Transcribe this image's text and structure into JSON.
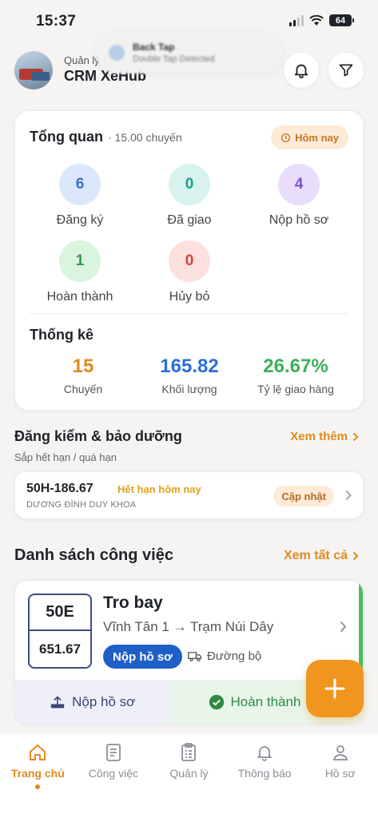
{
  "status_bar": {
    "time": "15:37",
    "battery": "64"
  },
  "notification": {
    "title": "Back Tap",
    "subtitle": "Double Tap Detected"
  },
  "header": {
    "subtitle": "Quản lý",
    "title": "CRM XeHub"
  },
  "overview": {
    "title": "Tổng quan",
    "count_label": "· 15.00 chuyến",
    "period_badge": "Hôm nay",
    "stats": [
      {
        "value": "6",
        "label": "Đăng ký",
        "color": "#3b6fd1",
        "bg": "#dbe7fb"
      },
      {
        "value": "0",
        "label": "Đã giao",
        "color": "#1a9f8e",
        "bg": "#d8f3ef"
      },
      {
        "value": "4",
        "label": "Nộp hồ sơ",
        "color": "#7a4fd1",
        "bg": "#e8ddfb"
      },
      {
        "value": "1",
        "label": "Hoàn thành",
        "color": "#2f9a48",
        "bg": "#d9f4df"
      },
      {
        "value": "0",
        "label": "Hủy bỏ",
        "color": "#d1453b",
        "bg": "#fbe0de"
      }
    ]
  },
  "statistics": {
    "title": "Thống kê",
    "items": [
      {
        "value": "15",
        "label": "Chuyến",
        "color": "#e08a1e"
      },
      {
        "value": "165.82",
        "label": "Khối lượng",
        "color": "#2b6fd6"
      },
      {
        "value": "26.67%",
        "label": "Tỷ lệ giao hàng",
        "color": "#3bb05a"
      }
    ]
  },
  "inspection": {
    "title": "Đăng kiểm & bảo dưỡng",
    "link": "Xem thêm",
    "subtitle": "Sắp hết hạn / quá hạn",
    "item": {
      "plate": "50H-186.67",
      "status": "Hết hạn hôm nay",
      "driver": "DƯƠNG ĐÌNH DUY KHOA",
      "action": "Cập nhật"
    }
  },
  "jobs": {
    "title": "Danh sách công việc",
    "link": "Xem tất cả",
    "item": {
      "plate_top": "50E",
      "plate_bottom": "651.67",
      "title": "Tro bay",
      "route": "Vĩnh Tân 1 → Trạm Núi Dây",
      "status": "Nộp hồ sơ",
      "transport": "Đường bộ",
      "action_submit": "Nộp hồ sơ",
      "action_done": "Hoàn thành"
    }
  },
  "nav": [
    {
      "label": "Trang chủ",
      "icon": "home-icon"
    },
    {
      "label": "Công việc",
      "icon": "document-icon"
    },
    {
      "label": "Quản lý",
      "icon": "clipboard-icon"
    },
    {
      "label": "Thông báo",
      "icon": "bell-icon"
    },
    {
      "label": "Hồ sơ",
      "icon": "user-icon"
    }
  ]
}
